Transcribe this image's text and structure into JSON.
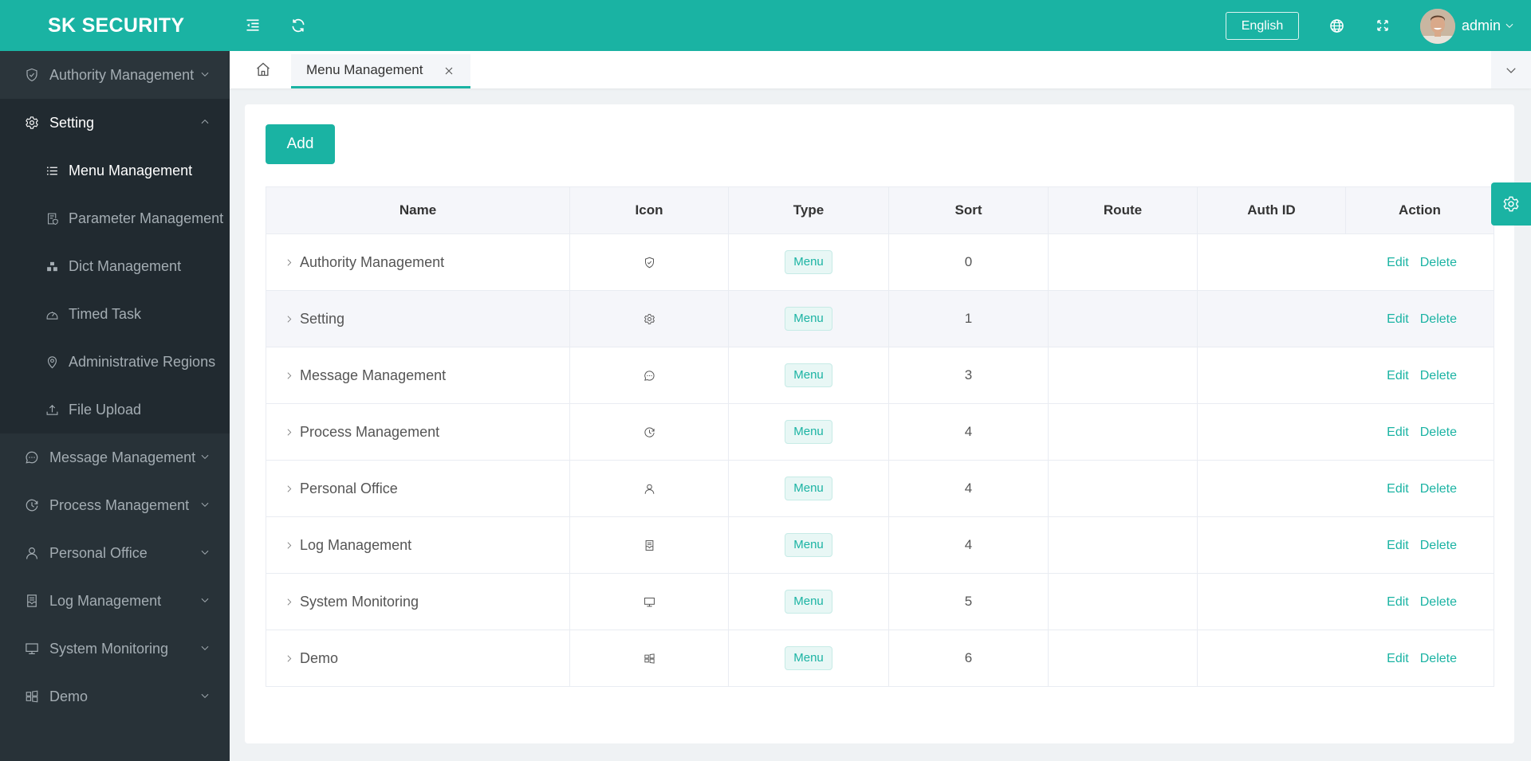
{
  "header": {
    "title": "SK SECURITY",
    "language_label": "English",
    "user_name": "admin",
    "icons": {
      "collapse": "menu-fold-icon",
      "refresh": "refresh-icon",
      "globe": "globe-icon",
      "fullscreen": "fullscreen-icon",
      "caret": "chevron-down-icon"
    }
  },
  "sidebar": {
    "items": [
      {
        "label": "Authority Management",
        "icon": "shield-check-icon",
        "expanded": false
      },
      {
        "label": "Setting",
        "icon": "gear-icon",
        "expanded": true,
        "children": [
          {
            "label": "Menu Management",
            "icon": "list-icon",
            "active": true
          },
          {
            "label": "Parameter Management",
            "icon": "document-shield-icon"
          },
          {
            "label": "Dict Management",
            "icon": "hierarchy-icon"
          },
          {
            "label": "Timed Task",
            "icon": "dashboard-icon"
          },
          {
            "label": "Administrative Regions",
            "icon": "location-icon"
          },
          {
            "label": "File Upload",
            "icon": "upload-icon"
          }
        ]
      },
      {
        "label": "Message Management",
        "icon": "chat-icon",
        "expanded": false
      },
      {
        "label": "Process Management",
        "icon": "clock-icon",
        "expanded": false
      },
      {
        "label": "Personal Office",
        "icon": "user-icon",
        "expanded": false
      },
      {
        "label": "Log Management",
        "icon": "log-icon",
        "expanded": false
      },
      {
        "label": "System Monitoring",
        "icon": "monitor-icon",
        "expanded": false
      },
      {
        "label": "Demo",
        "icon": "grid-icon",
        "expanded": false
      }
    ]
  },
  "tabs": {
    "home_icon": "home-icon",
    "items": [
      {
        "label": "Menu Management",
        "active": true
      }
    ]
  },
  "main": {
    "add_label": "Add",
    "table": {
      "columns": [
        "Name",
        "Icon",
        "Type",
        "Sort",
        "Route",
        "Auth ID",
        "Action"
      ],
      "rows": [
        {
          "name": "Authority Management",
          "icon": "shield-check-icon",
          "type": "Menu",
          "sort": "0",
          "route": "",
          "auth_id": "",
          "edit": "Edit",
          "delete": "Delete"
        },
        {
          "name": "Setting",
          "icon": "gear-icon",
          "type": "Menu",
          "sort": "1",
          "route": "",
          "auth_id": "",
          "edit": "Edit",
          "delete": "Delete"
        },
        {
          "name": "Message Management",
          "icon": "chat-icon",
          "type": "Menu",
          "sort": "3",
          "route": "",
          "auth_id": "",
          "edit": "Edit",
          "delete": "Delete"
        },
        {
          "name": "Process Management",
          "icon": "clock-icon",
          "type": "Menu",
          "sort": "4",
          "route": "",
          "auth_id": "",
          "edit": "Edit",
          "delete": "Delete"
        },
        {
          "name": "Personal Office",
          "icon": "user-icon",
          "type": "Menu",
          "sort": "4",
          "route": "",
          "auth_id": "",
          "edit": "Edit",
          "delete": "Delete"
        },
        {
          "name": "Log Management",
          "icon": "log-icon",
          "type": "Menu",
          "sort": "4",
          "route": "",
          "auth_id": "",
          "edit": "Edit",
          "delete": "Delete"
        },
        {
          "name": "System Monitoring",
          "icon": "monitor-icon",
          "type": "Menu",
          "sort": "5",
          "route": "",
          "auth_id": "",
          "edit": "Edit",
          "delete": "Delete"
        },
        {
          "name": "Demo",
          "icon": "grid-icon",
          "type": "Menu",
          "sort": "6",
          "route": "",
          "auth_id": "",
          "edit": "Edit",
          "delete": "Delete"
        }
      ]
    }
  },
  "colors": {
    "primary": "#1ab3a3",
    "sidebar_bg": "#283238",
    "submenu_bg": "#212a30",
    "page_bg": "#eff2f4"
  }
}
